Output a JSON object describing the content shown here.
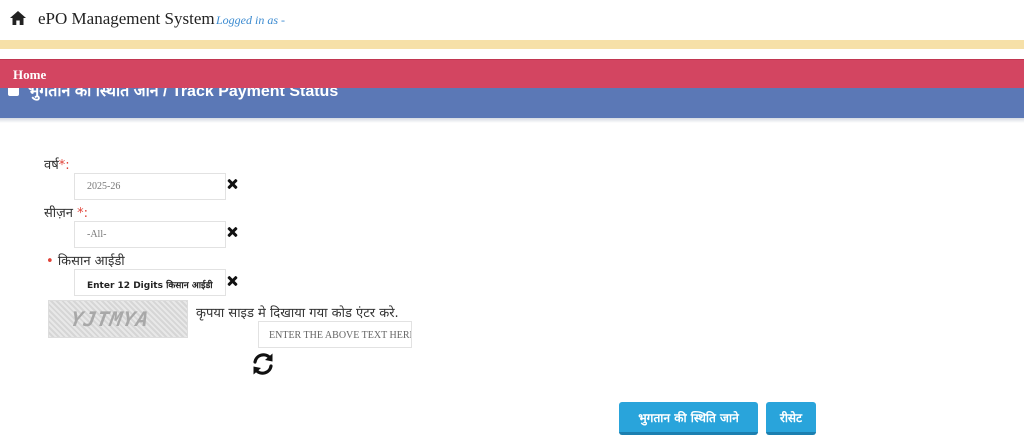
{
  "header": {
    "brand": "ePO Management System",
    "logged_in": "Logged in as -",
    "home_icon": "home-icon"
  },
  "nav": {
    "home_label": "Home"
  },
  "panel": {
    "title": "भुगतान की स्थिति जाने / Track Payment Status"
  },
  "form": {
    "year": {
      "label": "वर्ष",
      "required_mark": "*:",
      "value": "2025-26"
    },
    "season": {
      "label": "सीज़न",
      "required_mark": "*:",
      "value": "-All-"
    },
    "farmer_id": {
      "required_mark": "•",
      "label": "किसान आईडी",
      "placeholder": "Enter 12 Digits किसान आईडी"
    },
    "captcha": {
      "image_text": "YJTMYA",
      "hint": "कृपया साइड मे दिखाया गया कोड एंटर करे.",
      "input_placeholder": "ENTER THE ABOVE TEXT HERE",
      "refresh_icon": "refresh-icon"
    }
  },
  "actions": {
    "submit_label": "भुगतान की स्थिति जाने",
    "reset_label": "रीसेट"
  },
  "colors": {
    "nav_bar": "#d34561",
    "panel_header": "#5b78b6",
    "button": "#29a4db",
    "notice_strip": "#f6e0a8"
  }
}
